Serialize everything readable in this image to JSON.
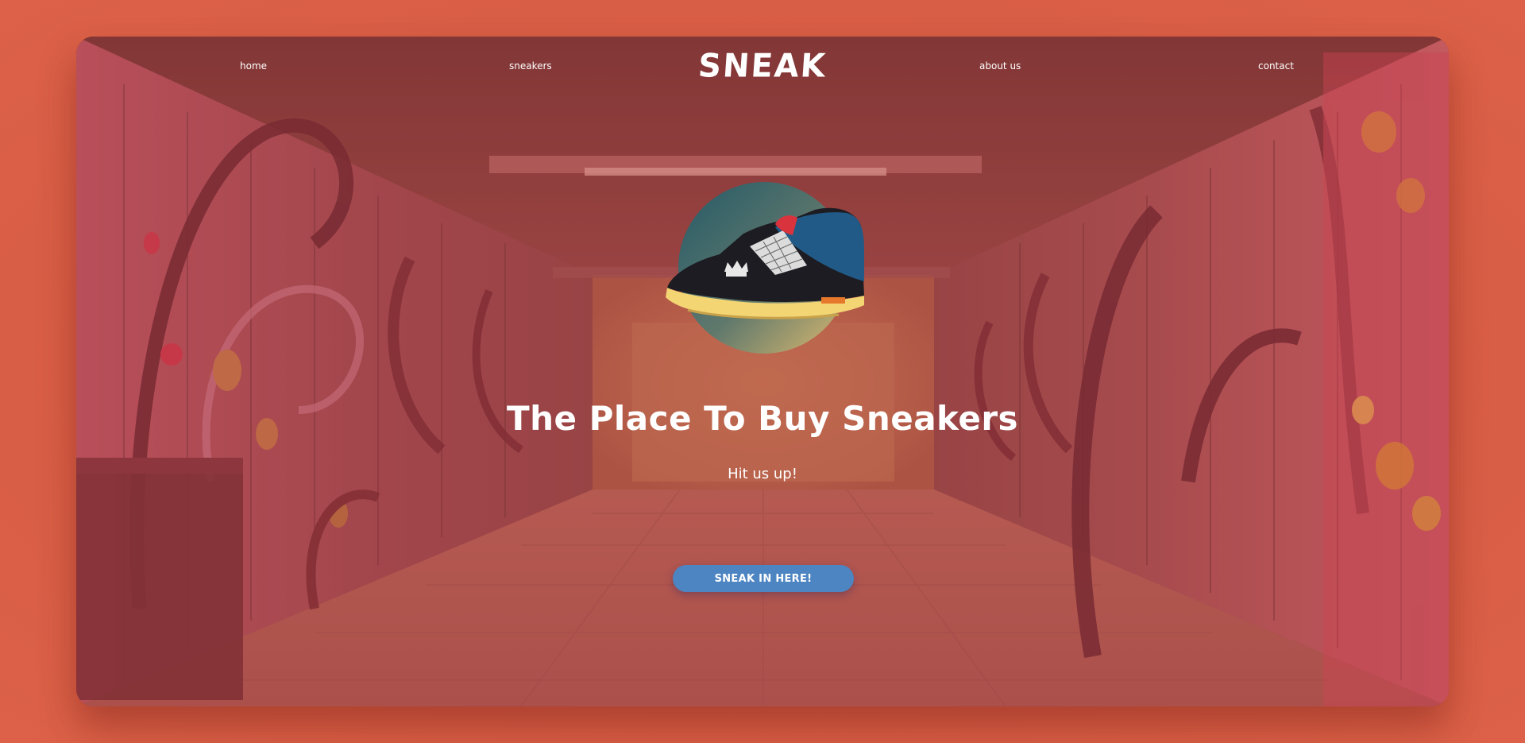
{
  "nav": {
    "home": "home",
    "sneakers": "sneakers",
    "logo": "SNEAK",
    "about": "about us",
    "contact": "contact"
  },
  "hero": {
    "headline": "The Place To Buy Sneakers",
    "subheadline": "Hit us up!",
    "cta_label": "SNEAK IN HERE!",
    "image": "sneaker-image",
    "background_image": "graffiti-tunnel-image"
  },
  "colors": {
    "page_background": "#d95c44",
    "cta_background": "#4d85c2",
    "text": "#ffffff"
  }
}
